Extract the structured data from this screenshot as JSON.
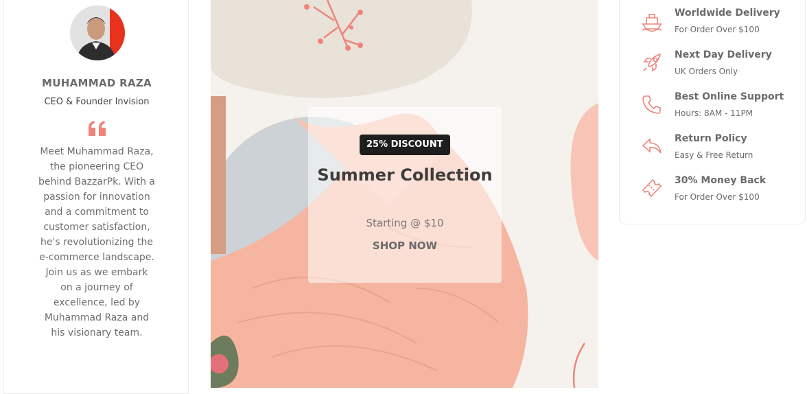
{
  "profile": {
    "name": "MUHAMMAD RAZA",
    "role": "CEO & Founder Invision",
    "bio": "Meet Muhammad Raza, the pioneering CEO behind BazzarPk. With a passion for innovation and a commitment to customer satisfaction, he's revolutionizing the e-commerce landscape. Join us as we embark on a journey of excellence, led by Muhammad Raza and his visionary team."
  },
  "banner": {
    "badge": "25% DISCOUNT",
    "title": "Summer Collection",
    "subtitle": "Starting @ $10",
    "cta": "SHOP NOW"
  },
  "features": [
    {
      "icon": "ship-icon",
      "title": "Worldwide Delivery",
      "desc": "For Order Over $100"
    },
    {
      "icon": "rocket-icon",
      "title": "Next Day Delivery",
      "desc": "UK Orders Only"
    },
    {
      "icon": "phone-icon",
      "title": "Best Online Support",
      "desc": "Hours: 8AM - 11PM"
    },
    {
      "icon": "return-arrow-icon",
      "title": "Return Policy",
      "desc": "Easy & Free Return"
    },
    {
      "icon": "ticket-icon",
      "title": "30% Money Back",
      "desc": "For Order Over $100"
    }
  ],
  "colors": {
    "accent": "#f0837a",
    "badge_bg": "#1e1e1e",
    "text_dark": "#3d3d3d",
    "text_muted": "#6b6b6b"
  }
}
